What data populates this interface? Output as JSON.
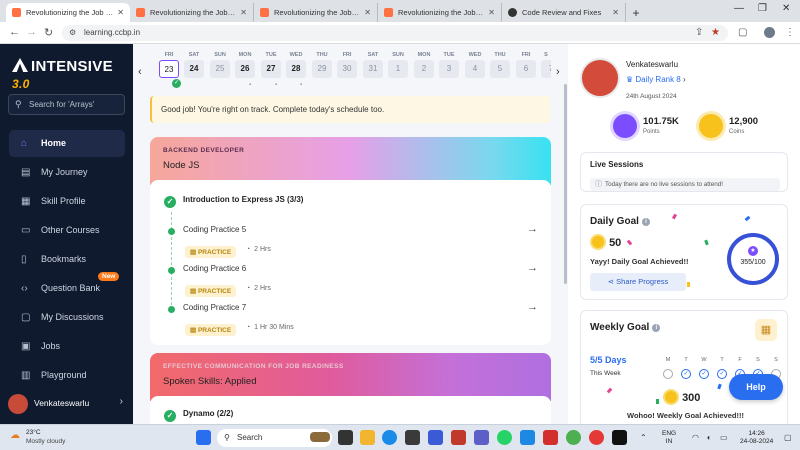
{
  "browser": {
    "tabs": [
      {
        "title": "Revolutionizing the Job Market"
      },
      {
        "title": "Revolutionizing the Job Market"
      },
      {
        "title": "Revolutionizing the Job Market"
      },
      {
        "title": "Revolutionizing the Job Market"
      },
      {
        "title": "Code Review and Fixes"
      }
    ],
    "url": "learning.ccbp.in"
  },
  "sidebar": {
    "logo_text": "INTENSIVE",
    "logo_version": "3.0",
    "search_placeholder": "Search for 'Arrays'",
    "items": [
      {
        "label": "Home"
      },
      {
        "label": "My Journey"
      },
      {
        "label": "Skill Profile"
      },
      {
        "label": "Other Courses"
      },
      {
        "label": "Bookmarks"
      },
      {
        "label": "Question Bank"
      },
      {
        "label": "My Discussions"
      },
      {
        "label": "Jobs"
      },
      {
        "label": "Playground"
      }
    ],
    "new_badge": "New",
    "user_name": "Venkateswarlu"
  },
  "calendar": {
    "days": [
      {
        "dn": "FRI",
        "dt": "23"
      },
      {
        "dn": "SAT",
        "dt": "24"
      },
      {
        "dn": "SUN",
        "dt": "25"
      },
      {
        "dn": "MON",
        "dt": "26"
      },
      {
        "dn": "TUE",
        "dt": "27"
      },
      {
        "dn": "WED",
        "dt": "28"
      },
      {
        "dn": "THU",
        "dt": "29"
      },
      {
        "dn": "FRI",
        "dt": "30"
      },
      {
        "dn": "SAT",
        "dt": "31"
      },
      {
        "dn": "SUN",
        "dt": "1"
      },
      {
        "dn": "MON",
        "dt": "2"
      },
      {
        "dn": "TUE",
        "dt": "3"
      },
      {
        "dn": "WED",
        "dt": "4"
      },
      {
        "dn": "THU",
        "dt": "5"
      },
      {
        "dn": "FRI",
        "dt": "6"
      },
      {
        "dn": "S",
        "dt": "7"
      }
    ]
  },
  "alert": "Good job! You're right on track. Complete today's schedule too.",
  "track1": {
    "category": "BACKEND DEVELOPER",
    "name": "Node JS",
    "module": "Introduction to Express JS (3/3)",
    "items": [
      {
        "title": "Coding Practice 5",
        "tag": "PRACTICE",
        "duration": "2 Hrs"
      },
      {
        "title": "Coding Practice 6",
        "tag": "PRACTICE",
        "duration": "2 Hrs"
      },
      {
        "title": "Coding Practice 7",
        "tag": "PRACTICE",
        "duration": "1 Hr 30 Mins"
      }
    ]
  },
  "track2": {
    "category": "EFFECTIVE COMMUNICATION FOR JOB READINESS",
    "name": "Spoken Skills: Applied",
    "module": "Dynamo (2/2)"
  },
  "profile": {
    "name": "Venkateswarlu",
    "rank": "Daily Rank 8",
    "date": "24th August 2024",
    "points_value": "101.75K",
    "points_label": "Points",
    "coins_value": "12,900",
    "coins_label": "Coins"
  },
  "live_sessions": {
    "title": "Live Sessions",
    "message": "Today there are no live sessions to attend!"
  },
  "daily_goal": {
    "title": "Daily Goal",
    "coins": "50",
    "message": "Yayy! Daily Goal Achieved!!",
    "share_label": "Share Progress",
    "progress": "355/100"
  },
  "weekly_goal": {
    "title": "Weekly Goal",
    "days": "5/5 Days",
    "week_label": "This Week",
    "weekdays": [
      "M",
      "T",
      "W",
      "T",
      "F",
      "S",
      "S"
    ],
    "coins": "300",
    "message": "Wohoo! Weekly Goal Achieved!!!"
  },
  "help_label": "Help",
  "taskbar": {
    "temp": "23°C",
    "weather": "Mostly cloudy",
    "search": "Search",
    "lang1": "ENG",
    "lang2": "IN",
    "time": "14:26",
    "date": "24-08-2024"
  },
  "colors": {
    "sidebar_bg": "#0f1a2f",
    "accent_purple": "#7c4dff",
    "accent_blue": "#2a6ef0",
    "success": "#27ae60"
  }
}
